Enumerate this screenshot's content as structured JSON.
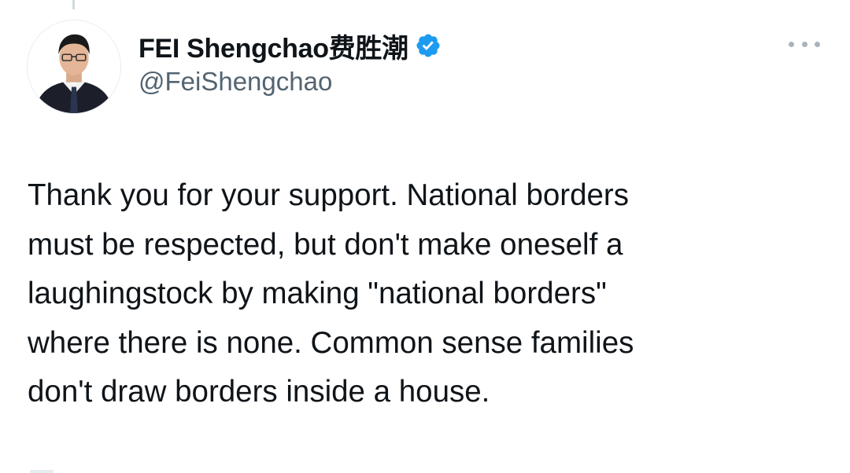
{
  "tweet": {
    "author": {
      "display_name": "FEI Shengchao费胜潮",
      "handle": "@FeiShengchao",
      "verified": true,
      "verified_icon": "verified-badge-icon",
      "avatar_icon": "profile-photo"
    },
    "more_icon": "more-options-icon",
    "text_lines": [
      "Thank you for your support. National borders",
      "must be respected, but don't make oneself a",
      "laughingstock by making \"national borders\"",
      "where there is none. Common sense families",
      "don't draw borders inside a house."
    ]
  },
  "colors": {
    "text_primary": "#0f1419",
    "text_secondary": "#536471",
    "verified_blue": "#1d9bf0"
  }
}
